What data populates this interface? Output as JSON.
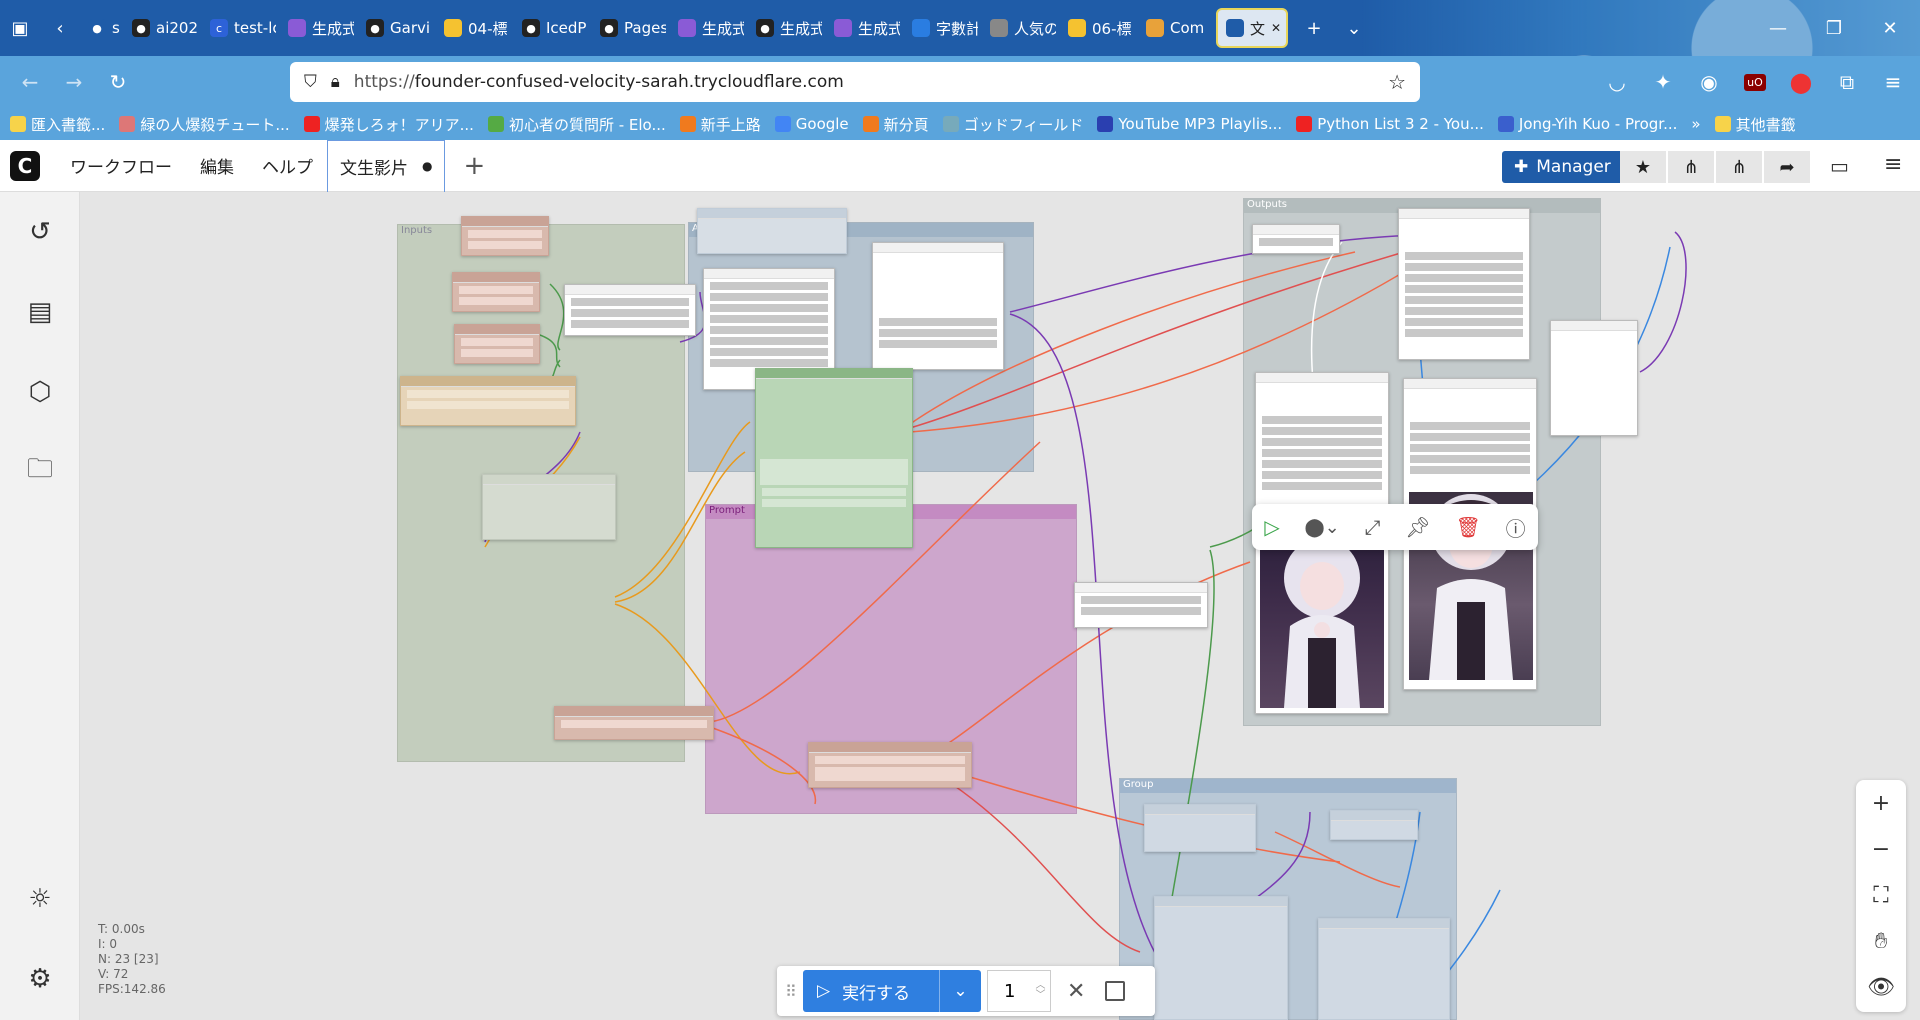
{
  "browser": {
    "tabs": [
      {
        "label": "siet",
        "fav": "github",
        "color": "#1f5ca8"
      },
      {
        "label": "ai202",
        "fav": "github",
        "color": "#222"
      },
      {
        "label": "test-lc",
        "fav": "c",
        "color": "#2d62d8"
      },
      {
        "label": "生成式",
        "fav": "app",
        "color": "#8a5bd6"
      },
      {
        "label": "Garvi",
        "fav": "github",
        "color": "#222"
      },
      {
        "label": "04-標",
        "fav": "doc",
        "color": "#f5c230"
      },
      {
        "label": "IcedP",
        "fav": "github",
        "color": "#222"
      },
      {
        "label": "Pages",
        "fav": "github",
        "color": "#222"
      },
      {
        "label": "生成式",
        "fav": "app",
        "color": "#8a5bd6"
      },
      {
        "label": "生成式",
        "fav": "github",
        "color": "#222"
      },
      {
        "label": "生成式",
        "fav": "app",
        "color": "#8a5bd6"
      },
      {
        "label": "字數計",
        "fav": "star",
        "color": "#2a7de1"
      },
      {
        "label": "人気の",
        "fav": "anime",
        "color": "#888"
      },
      {
        "label": "06-標",
        "fav": "doc",
        "color": "#f5c230"
      },
      {
        "label": "Com",
        "fav": "infinity",
        "color": "#e8a23a"
      },
      {
        "label": "文",
        "fav": "comfy",
        "color": "#1f5ca8"
      }
    ],
    "url_protocol": "https://",
    "url_host": "founder-confused-velocity-sarah.trycloudflare.com",
    "bookmarks": [
      {
        "label": "匯入書籤...",
        "color": "#f7d34a"
      },
      {
        "label": "緑の人爆殺チュート...",
        "color": "#d77"
      },
      {
        "label": "爆発しろォ！アリア...",
        "color": "#e22"
      },
      {
        "label": "初心者の質問所 - Elo...",
        "color": "#5a4"
      },
      {
        "label": "新手上路",
        "color": "#f07a1e"
      },
      {
        "label": "Google",
        "color": "#4285f4"
      },
      {
        "label": "新分頁",
        "color": "#f07a1e"
      },
      {
        "label": "ゴッドフィールド",
        "color": "#7ab"
      },
      {
        "label": "YouTube MP3 Playlis...",
        "color": "#2a3fb0"
      },
      {
        "label": "Python List 3 2 - You...",
        "color": "#e22"
      },
      {
        "label": "Jong-Yih Kuo - Progr...",
        "color": "#3a5fcd"
      },
      {
        "label": "其他書籤",
        "color": "#f7d34a"
      }
    ]
  },
  "app": {
    "menu": [
      "ワークフロー",
      "編集",
      "ヘルプ"
    ],
    "workflow_tab": "文生影片",
    "workflow_dirty_dot": "●",
    "manager_label": "Manager"
  },
  "canvas": {
    "groups": {
      "inputs": "Inputs",
      "animate": "Animate Diff Nodes",
      "prompt": "Prompt",
      "outputs": "Outputs",
      "group": "Group"
    },
    "stats": {
      "t": "T: 0.00s",
      "i": "I: 0",
      "n": "N: 23 [23]",
      "v": "V: 72",
      "fps": "FPS:142.86"
    }
  },
  "runbar": {
    "run_label": "実行する",
    "queue_count": "1"
  },
  "colors": {
    "inputs_group": "#c3cdbd",
    "animate_group": "#b5c3cf",
    "prompt_group": "#cda6cc",
    "outputs_group": "#c4cbcc",
    "group_group": "#b9c8d6",
    "run_button": "#2f7fe0",
    "manager_button": "#1f5ca8"
  }
}
